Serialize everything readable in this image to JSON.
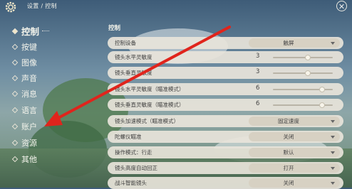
{
  "breadcrumb": "设置 / 控制",
  "sidebar": {
    "items": [
      {
        "label": "控制"
      },
      {
        "label": "按键"
      },
      {
        "label": "图像"
      },
      {
        "label": "声音"
      },
      {
        "label": "消息"
      },
      {
        "label": "语言"
      },
      {
        "label": "账户"
      },
      {
        "label": "资源"
      },
      {
        "label": "其他"
      }
    ],
    "active_index": 0
  },
  "section_title": "控制",
  "settings": [
    {
      "label": "控制设备",
      "type": "select",
      "value": "触屏"
    },
    {
      "label": "镜头水平灵敏度",
      "type": "slider",
      "value": "3",
      "level": 0.58
    },
    {
      "label": "镜头垂直灵敏度",
      "type": "slider",
      "value": "3",
      "level": 0.58
    },
    {
      "label": "镜头水平灵敏度（瞄准模式）",
      "type": "slider",
      "value": "6",
      "level": 0.82
    },
    {
      "label": "镜头垂直灵敏度（瞄准模式）",
      "type": "slider",
      "value": "6",
      "level": 0.82
    },
    {
      "label": "镜头加速模式（瞄准模式）",
      "type": "select",
      "value": "固定速度"
    },
    {
      "label": "陀螺仪瞄准",
      "type": "select",
      "value": "关闭"
    },
    {
      "label": "操作模式：行走",
      "type": "select",
      "value": "默认"
    },
    {
      "label": "镜头高度自动回正",
      "type": "select",
      "value": "打开"
    },
    {
      "label": "战斗智能镜头",
      "type": "select",
      "value": "关闭"
    }
  ],
  "colors": {
    "annotation_arrow": "#e0241c"
  }
}
